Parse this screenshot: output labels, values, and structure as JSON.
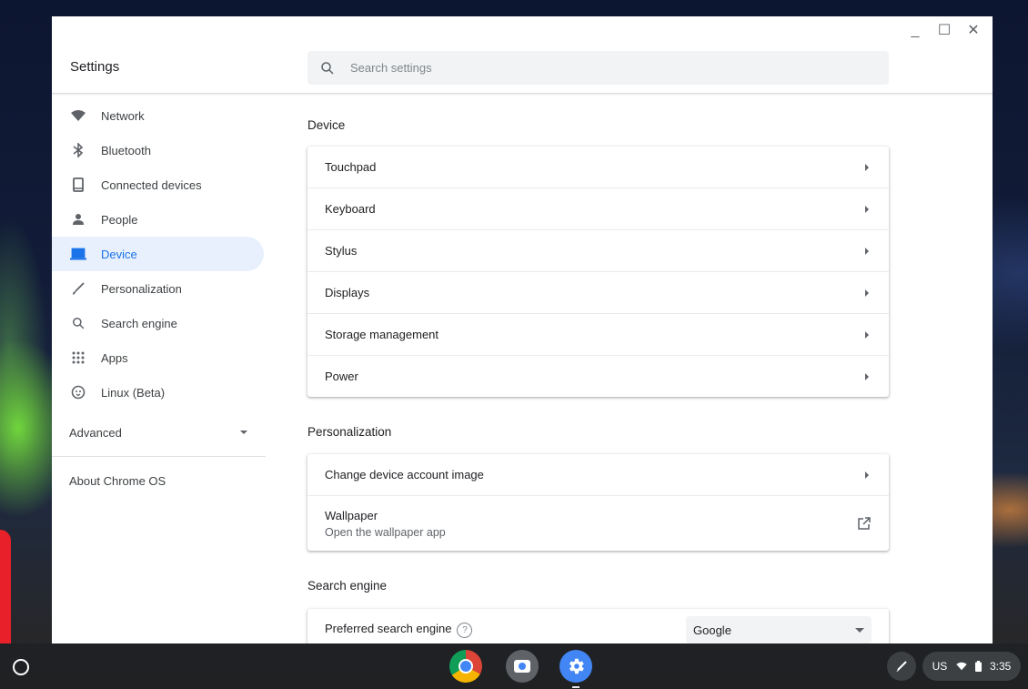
{
  "window": {
    "minimize": "_",
    "maximize": "☐",
    "close": "✕"
  },
  "header": {
    "title": "Settings",
    "search_placeholder": "Search settings"
  },
  "sidebar": {
    "items": [
      {
        "label": "Network",
        "icon": "wifi-icon"
      },
      {
        "label": "Bluetooth",
        "icon": "bluetooth-icon"
      },
      {
        "label": "Connected devices",
        "icon": "phone-icon"
      },
      {
        "label": "People",
        "icon": "person-icon"
      },
      {
        "label": "Device",
        "icon": "laptop-icon",
        "selected": true
      },
      {
        "label": "Personalization",
        "icon": "brush-icon"
      },
      {
        "label": "Search engine",
        "icon": "search-icon"
      },
      {
        "label": "Apps",
        "icon": "apps-grid-icon"
      },
      {
        "label": "Linux (Beta)",
        "icon": "penguin-icon"
      }
    ],
    "advanced": "Advanced",
    "about": "About Chrome OS"
  },
  "main": {
    "device": {
      "title": "Device",
      "rows": [
        "Touchpad",
        "Keyboard",
        "Stylus",
        "Displays",
        "Storage management",
        "Power"
      ]
    },
    "personalization": {
      "title": "Personalization",
      "account_image": "Change device account image",
      "wallpaper_title": "Wallpaper",
      "wallpaper_sub": "Open the wallpaper app"
    },
    "search_engine": {
      "title": "Search engine",
      "preferred_label": "Preferred search engine",
      "help": "?",
      "selected": "Google"
    }
  },
  "shelf": {
    "ime": "US",
    "time": "3:35"
  },
  "colors": {
    "accent": "#1a73e8",
    "selected_bg": "#e8f0fe",
    "shelf": "#202124"
  }
}
